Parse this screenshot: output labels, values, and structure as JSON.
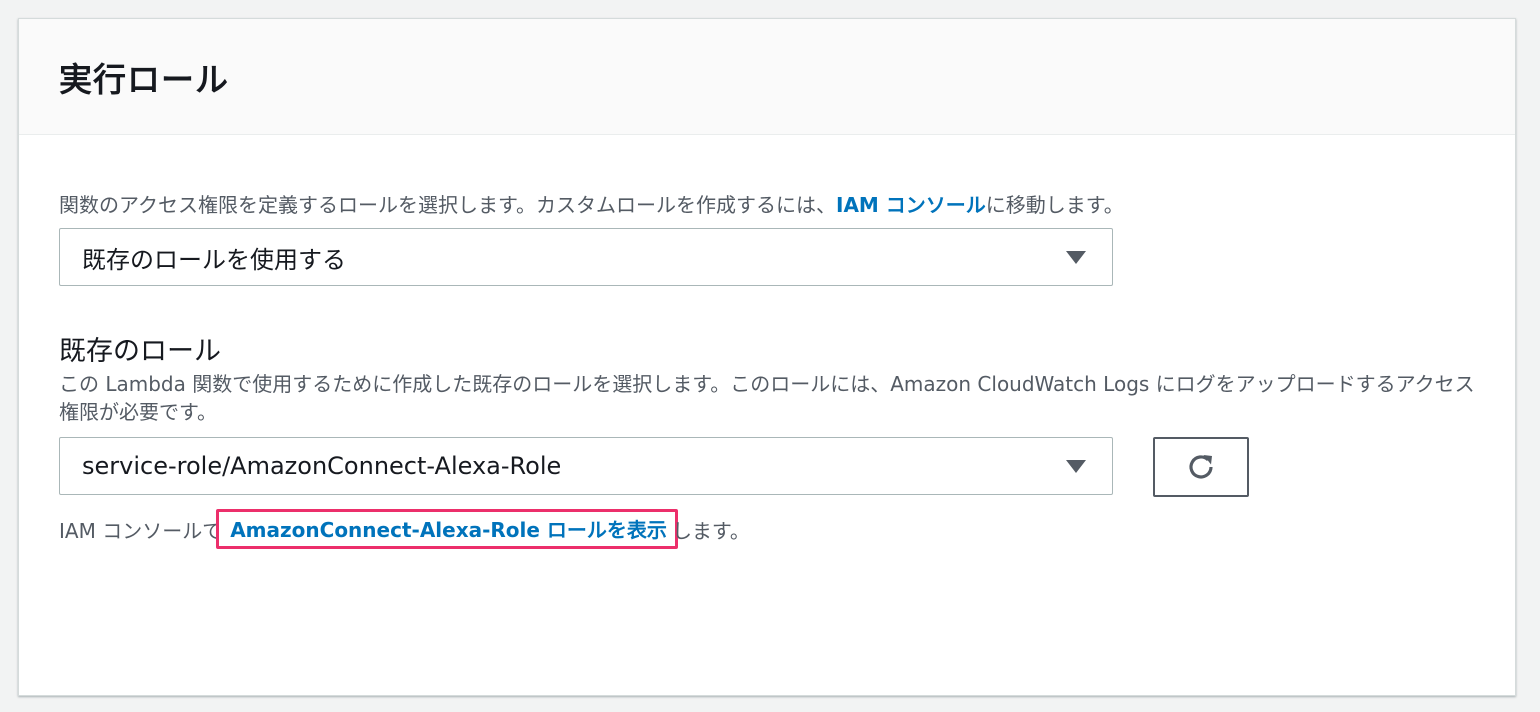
{
  "panel": {
    "title": "実行ロール"
  },
  "execution_role": {
    "description_before": "関数のアクセス権限を定義するロールを選択します。カスタムロールを作成するには、",
    "description_link": "IAM コンソール",
    "description_after": "に移動します。",
    "selected_option": "既存のロールを使用する"
  },
  "existing_role": {
    "label": "既存のロール",
    "description": "この Lambda 関数で使用するために作成した既存のロールを選択します。このロールには、Amazon CloudWatch Logs にログをアップロードするアクセス権限が必要です。",
    "selected_role": "service-role/AmazonConnect-Alexa-Role",
    "refresh_icon": "refresh-icon",
    "view_before": "IAM コンソールで",
    "view_link": "AmazonConnect-Alexa-Role ロールを表示",
    "view_after": "します。"
  },
  "colors": {
    "link": "#0073bb",
    "highlight": "#ec2f6b",
    "text": "#16191f",
    "secondary_text": "#545b64"
  }
}
